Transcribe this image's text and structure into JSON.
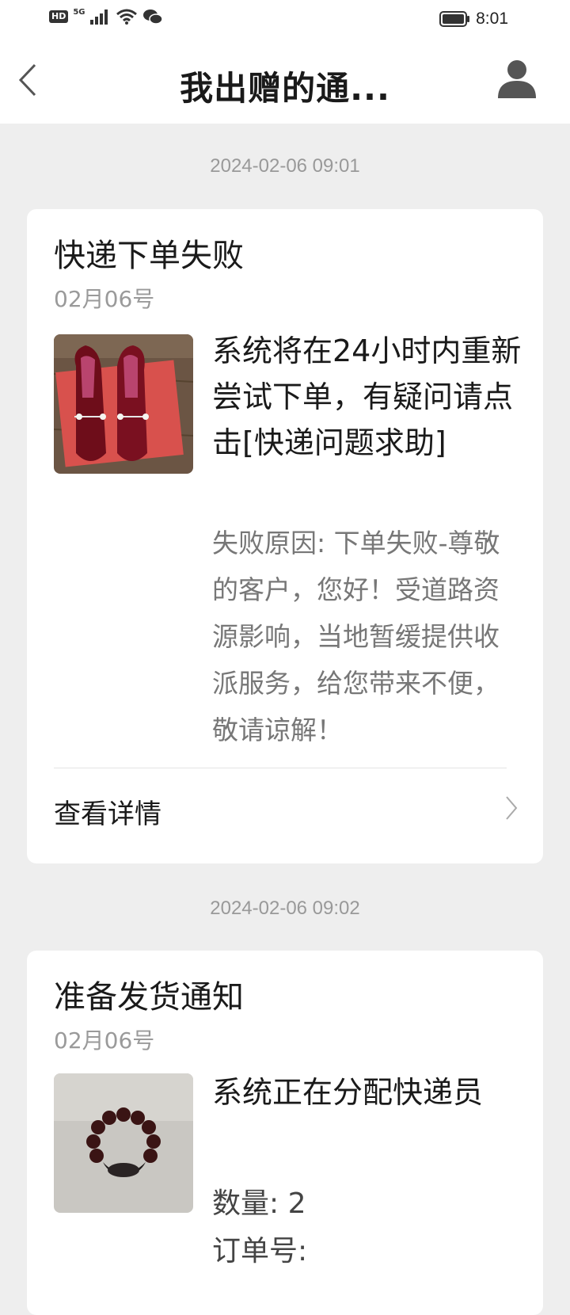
{
  "status_bar": {
    "hd": "HD",
    "network": "5G",
    "time": "8:01"
  },
  "header": {
    "title": "我出赠的通..."
  },
  "messages": [
    {
      "timestamp": "2024-02-06 09:01",
      "title": "快递下单失败",
      "date": "02月06号",
      "thumb_icon": "red-loafer-shoes-photo",
      "main_text": "系统将在24小时内重新尝试下单，有疑问请点击[快递问题求助]",
      "sub_text": "失败原因: 下单失败-尊敬的客户，您好！受道路资源影响，当地暂缓提供收派服务，给您带来不便，敬请谅解！",
      "detail_label": "查看详情"
    },
    {
      "timestamp": "2024-02-06 09:02",
      "title": "准备发货通知",
      "date": "02月06号",
      "thumb_icon": "bead-bracelet-photo",
      "main_text": "系统正在分配快递员",
      "qty_text": "数量: 2",
      "order_text": "订单号:"
    }
  ],
  "colors": {
    "background": "#eeeeee",
    "card": "#ffffff",
    "muted_text": "#999999",
    "shoe_red": "#7a0f1c"
  }
}
